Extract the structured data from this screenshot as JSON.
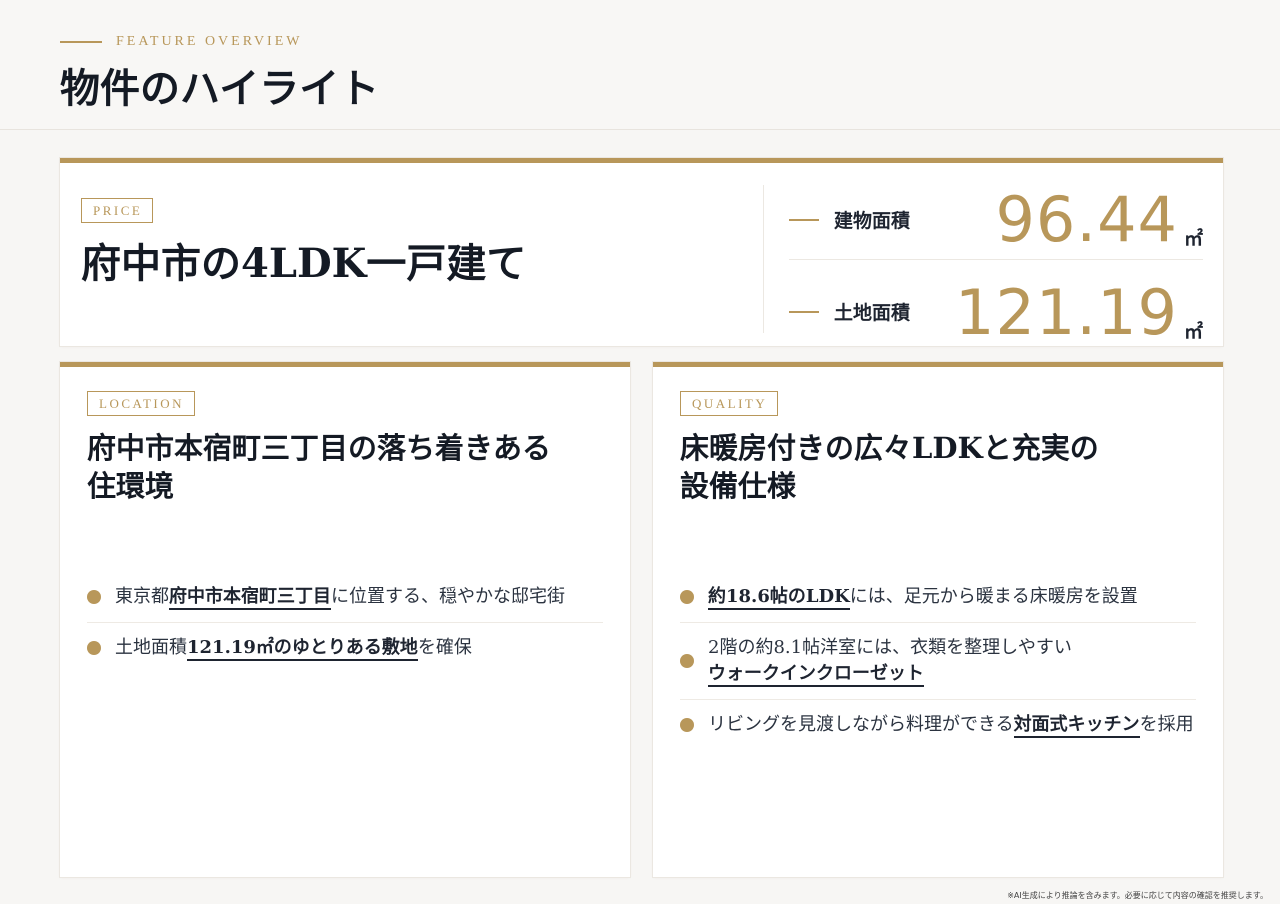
{
  "header": {
    "eyebrow": "FEATURE OVERVIEW",
    "title": "物件のハイライト"
  },
  "price_card": {
    "tag": "PRICE",
    "title": "府中市の4LDK一戸建て",
    "specs": [
      {
        "label": "建物面積",
        "value": "96.44",
        "unit": "㎡"
      },
      {
        "label": "土地面積",
        "value": "121.19",
        "unit": "㎡"
      }
    ]
  },
  "location_card": {
    "tag": "LOCATION",
    "title": "府中市本宿町三丁目の落ち着きある\n住環境",
    "bullets": [
      {
        "before": "東京都",
        "highlight": "府中市本宿町三丁目",
        "after": "に位置する、穏やかな邸宅街"
      },
      {
        "before": "土地面積",
        "highlight": "121.19㎡のゆとりある敷地",
        "after": "を確保"
      }
    ]
  },
  "quality_card": {
    "tag": "QUALITY",
    "title": "床暖房付きの広々LDKと充実の\n設備仕様",
    "bullets": [
      {
        "before": "",
        "highlight": "約18.6帖のLDK",
        "after": "には、足元から暖まる床暖房を設置"
      },
      {
        "before": "2階の約8.1帖洋室には、衣類を整理しやすい",
        "highlight": "ウォークインクローゼット",
        "after": ""
      },
      {
        "before": "リビングを見渡しながら料理ができる",
        "highlight": "対面式キッチン",
        "after": "を採用"
      }
    ]
  },
  "footnote": "※AI生成により推論を含みます。必要に応じて内容の確認を推奨します。",
  "colors": {
    "accent": "#b8975a",
    "text": "#1e2430",
    "background": "#f7f6f4"
  }
}
